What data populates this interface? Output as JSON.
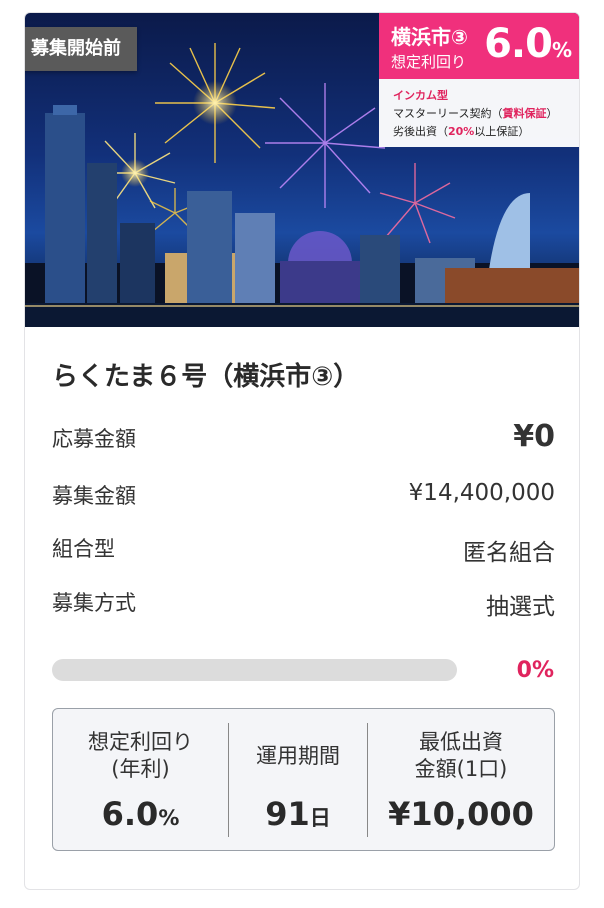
{
  "status_label": "募集開始前",
  "badge": {
    "city": "横浜市③",
    "subtitle": "想定利回り",
    "rate_value": "6.0",
    "rate_unit": "%",
    "type_label": "インカム型",
    "master_lease_prefix": "マスターリース契約（",
    "master_lease_highlight": "賃料保証",
    "master_lease_suffix": "）",
    "subordinate_prefix": "劣後出資（",
    "subordinate_highlight": "20%",
    "subordinate_suffix": "以上保証）"
  },
  "title": "らくたま６号（横浜市③）",
  "details": [
    {
      "label": "応募金額",
      "value": "¥0"
    },
    {
      "label": "募集金額",
      "value": "¥14,400,000"
    },
    {
      "label": "組合型",
      "value": "匿名組合"
    },
    {
      "label": "募集方式",
      "value": "抽選式"
    }
  ],
  "progress": {
    "value": 0,
    "label": "0%"
  },
  "stats": {
    "yield_label_1": "想定利回り",
    "yield_label_2": "(年利)",
    "yield_value": "6.0",
    "yield_unit": "%",
    "period_label": "運用期間",
    "period_value": "91",
    "period_unit": "日",
    "min_label_1": "最低出資",
    "min_label_2": "金額(1口)",
    "min_value": "¥10,000"
  },
  "colors": {
    "accent": "#f0307c",
    "accent_text": "#e0245e",
    "status_bg": "#5a5a5a"
  }
}
